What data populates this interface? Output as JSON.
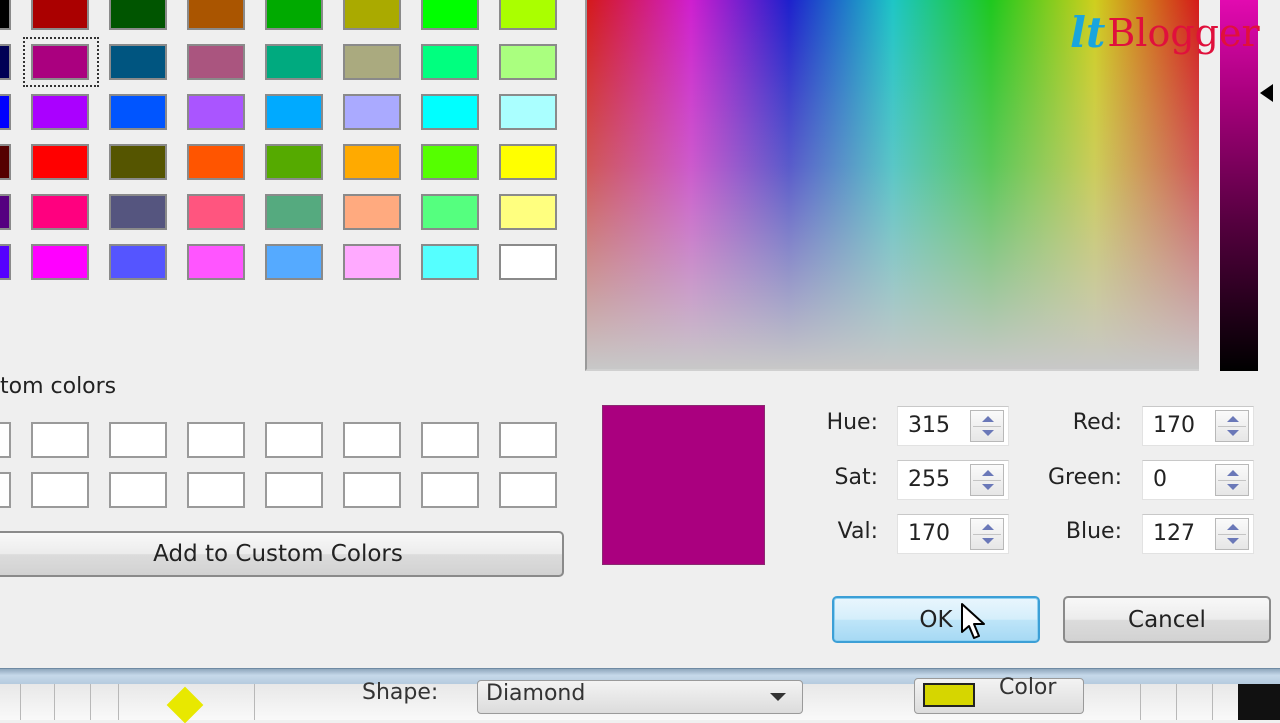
{
  "dialog": {
    "basic_colors": [
      [
        "#000000",
        "#aa0000",
        "#005500",
        "#aa5500",
        "#00aa00",
        "#aaaa00",
        "#00ff00",
        "#aaff00"
      ],
      [
        "#000055",
        "#aa007f",
        "#005580",
        "#aa557f",
        "#00aa7f",
        "#aaaa7f",
        "#00ff7f",
        "#aaff7f"
      ],
      [
        "#0000ff",
        "#aa00ff",
        "#0055ff",
        "#aa55ff",
        "#00aaff",
        "#aaaaff",
        "#00ffff",
        "#aaffff"
      ],
      [
        "#550000",
        "#ff0000",
        "#555500",
        "#ff5500",
        "#55aa00",
        "#ffaa00",
        "#55ff00",
        "#ffff00"
      ],
      [
        "#550080",
        "#ff007f",
        "#55557f",
        "#ff557f",
        "#55aa7f",
        "#ffaa7f",
        "#55ff7f",
        "#ffff7f"
      ],
      [
        "#5500ff",
        "#ff00ff",
        "#5555ff",
        "#ff55ff",
        "#55aaff",
        "#ffaaff",
        "#55ffff",
        "#ffffff"
      ]
    ],
    "selected_swatch": {
      "row": 1,
      "col": 1
    },
    "custom_colors_label": "tom colors",
    "custom_colors": [
      [
        "#ffffff",
        "#ffffff",
        "#ffffff",
        "#ffffff",
        "#ffffff",
        "#ffffff",
        "#ffffff",
        "#ffffff"
      ],
      [
        "#ffffff",
        "#ffffff",
        "#ffffff",
        "#ffffff",
        "#ffffff",
        "#ffffff",
        "#ffffff",
        "#ffffff"
      ]
    ],
    "add_custom_label": "Add to Custom Colors",
    "preview_color": "#aa007f",
    "hsv": {
      "hue_label": "Hue:",
      "hue": "315",
      "sat_label": "Sat:",
      "sat": "255",
      "val_label": "Val:",
      "val": "170"
    },
    "rgb": {
      "red_label": "Red:",
      "red": "170",
      "green_label": "Green:",
      "green": "0",
      "blue_label": "Blue:",
      "blue": "127"
    },
    "ok_label": "OK",
    "cancel_label": "Cancel",
    "luminance_level": 0.67
  },
  "watermark": {
    "logo": "lt",
    "text": "Blogger"
  },
  "background_window": {
    "shape_label": "Shape:",
    "shape_value": "Diamond",
    "color_button_label": "Color",
    "color_chip": "#d6d600",
    "diamond_color": "#e8e800"
  }
}
